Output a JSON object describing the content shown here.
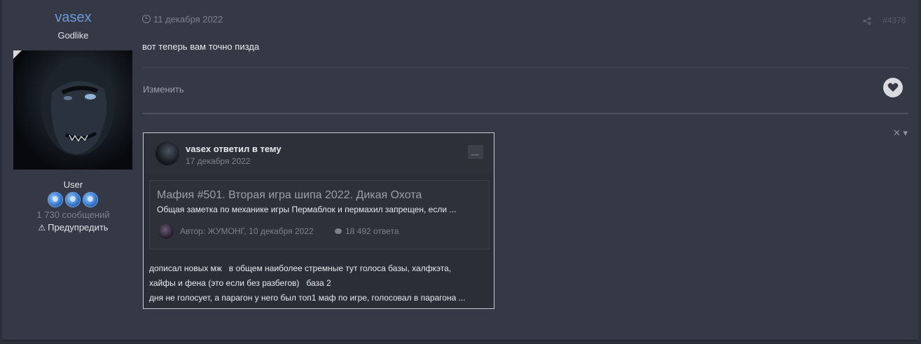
{
  "author": {
    "name": "vasex",
    "rank": "Godlike",
    "group": "User",
    "post_count": "1 730 сообщений",
    "warn_label": "Предупредить"
  },
  "post": {
    "date": "11 декабря 2022",
    "number": "#4378",
    "text": "вот теперь вам точно пизда",
    "edit_label": "Изменить"
  },
  "embed": {
    "title": "vasex ответил в тему",
    "date": "17 декабря 2022",
    "quote": {
      "title": "Мафия #501. Вторая игра шипа 2022. Дикая Охота",
      "excerpt": "Общая заметка по механике игры Пермаблок и пермахил запрещен, если ...",
      "author": "Автор: ЖУМОНГ, 10 декабря 2022",
      "replies": "18 492 ответа"
    },
    "body_lines": [
      "дописал новых мж   в общем наиболее стремные тут голоса базы, халфкэта,",
      "хайфы и фена (это если без разбегов)   база 2",
      "дня не голосует, а парагон у него был топ1 маф по игре, голосовал в парагона ..."
    ]
  },
  "icons": {
    "clock": "clock-icon",
    "share": "share-icon",
    "like": "heart-icon",
    "close": "close-icon",
    "warn": "warning-icon",
    "comment": "comment-icon",
    "image": "image-icon"
  },
  "colors": {
    "accent": "#6d9ad8",
    "background": "#343945"
  }
}
